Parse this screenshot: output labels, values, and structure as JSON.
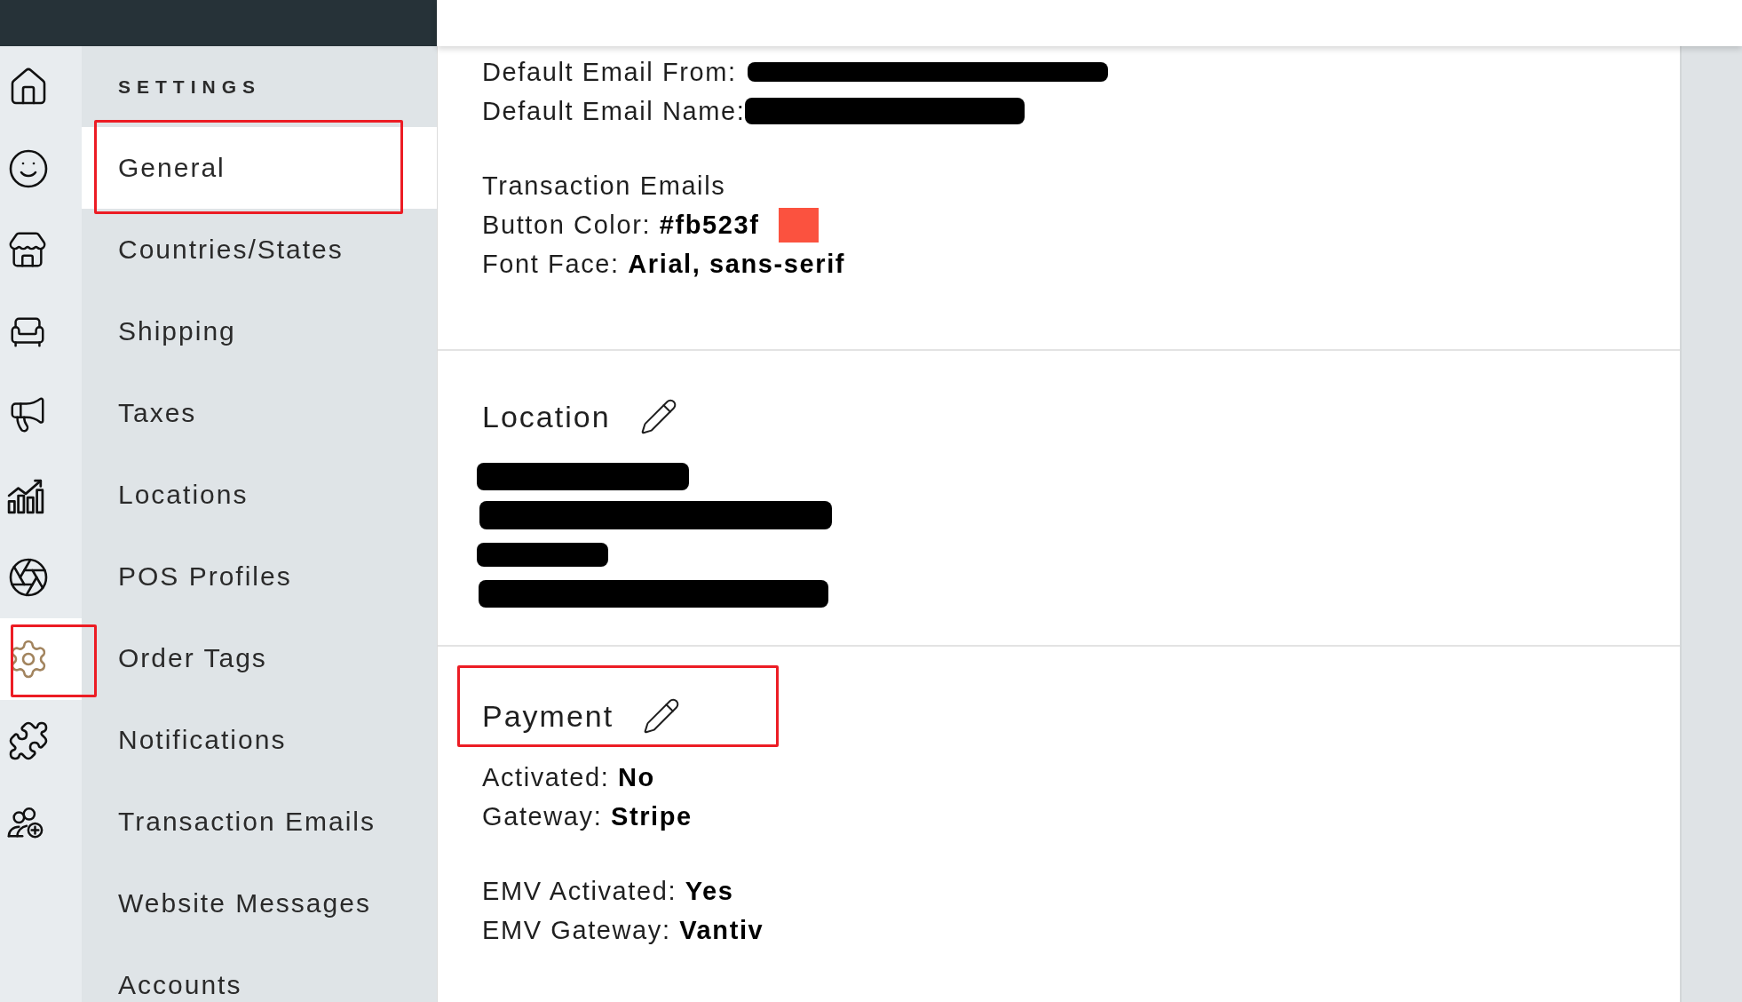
{
  "rail": {
    "items": [
      {
        "selected": false,
        "highlighted": false
      },
      {
        "selected": false,
        "highlighted": false
      },
      {
        "selected": false,
        "highlighted": false
      },
      {
        "selected": false,
        "highlighted": false
      },
      {
        "selected": false,
        "highlighted": false
      },
      {
        "selected": false,
        "highlighted": false
      },
      {
        "selected": false,
        "highlighted": false
      },
      {
        "selected": true,
        "highlighted": true
      },
      {
        "selected": false,
        "highlighted": false
      },
      {
        "selected": false,
        "highlighted": false
      }
    ]
  },
  "settings_nav": {
    "title": "SETTINGS",
    "items": [
      {
        "label": "General",
        "selected": true,
        "highlighted": true
      },
      {
        "label": "Countries/States",
        "selected": false,
        "highlighted": false
      },
      {
        "label": "Shipping",
        "selected": false,
        "highlighted": false
      },
      {
        "label": "Taxes",
        "selected": false,
        "highlighted": false
      },
      {
        "label": "Locations",
        "selected": false,
        "highlighted": false
      },
      {
        "label": "POS Profiles",
        "selected": false,
        "highlighted": false
      },
      {
        "label": "Order Tags",
        "selected": false,
        "highlighted": false
      },
      {
        "label": "Notifications",
        "selected": false,
        "highlighted": false
      },
      {
        "label": "Transaction Emails",
        "selected": false,
        "highlighted": false
      },
      {
        "label": "Website Messages",
        "selected": false,
        "highlighted": false
      },
      {
        "label": "Accounts",
        "selected": false,
        "highlighted": false
      }
    ]
  },
  "email_settings": {
    "fields": [
      {
        "label": "Default Email From:",
        "redacted": true
      },
      {
        "label": "Default Email Name:",
        "redacted": true
      }
    ],
    "group_title": "Transaction Emails",
    "button_color": {
      "label": "Button Color:",
      "value": "#fb523f",
      "color": "#fb523f"
    },
    "font_face": {
      "label": "Font Face:",
      "value": "Arial, sans-serif"
    }
  },
  "location": {
    "title": "Location",
    "highlighted": false,
    "lines": [
      {
        "redacted": true
      },
      {
        "redacted": true
      },
      {
        "redacted": true
      },
      {
        "redacted": true
      }
    ]
  },
  "payment": {
    "title": "Payment",
    "highlighted": true,
    "groups": [
      [
        {
          "label": "Activated:",
          "value": "No"
        },
        {
          "label": "Gateway:",
          "value": "Stripe"
        }
      ],
      [
        {
          "label": "EMV Activated:",
          "value": "Yes"
        },
        {
          "label": "EMV Gateway:",
          "value": "Vantiv"
        }
      ]
    ]
  }
}
